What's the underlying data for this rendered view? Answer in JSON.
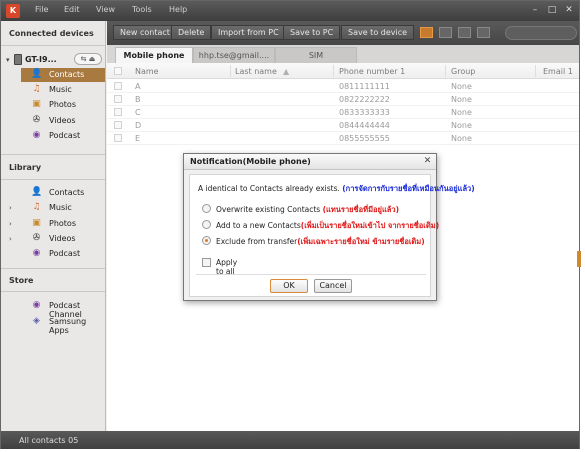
{
  "menu": {
    "logo": "K",
    "items": [
      "File",
      "Edit",
      "View",
      "Tools",
      "Help"
    ]
  },
  "window_controls": {
    "minimize": "–",
    "maximize": "□",
    "close": "✕"
  },
  "sidebar": {
    "connected_heading": "Connected devices",
    "device_name": "GT-I9...",
    "device_button": "⇆ ⏏",
    "device_items": [
      {
        "label": "Contacts",
        "icon": "contacts-icon",
        "glyph": "👤"
      },
      {
        "label": "Music",
        "icon": "music-icon",
        "glyph": "♫"
      },
      {
        "label": "Photos",
        "icon": "photos-icon",
        "glyph": "▣"
      },
      {
        "label": "Videos",
        "icon": "videos-icon",
        "glyph": "✇"
      },
      {
        "label": "Podcast",
        "icon": "podcast-icon",
        "glyph": "◉"
      }
    ],
    "library_heading": "Library",
    "library_items": [
      {
        "label": "Contacts",
        "icon": "contacts-icon",
        "glyph": "👤"
      },
      {
        "label": "Music",
        "icon": "music-icon",
        "glyph": "♫"
      },
      {
        "label": "Photos",
        "icon": "photos-icon",
        "glyph": "▣"
      },
      {
        "label": "Videos",
        "icon": "videos-icon",
        "glyph": "✇"
      },
      {
        "label": "Podcast",
        "icon": "podcast-icon",
        "glyph": "◉"
      }
    ],
    "store_heading": "Store",
    "store_items": [
      {
        "label": "Podcast Channel",
        "icon": "podcast-channel-icon",
        "glyph": "◉"
      },
      {
        "label": "Samsung Apps",
        "icon": "samsung-apps-icon",
        "glyph": "◈"
      }
    ]
  },
  "toolbar": {
    "buttons": [
      "New contact",
      "Delete",
      "Import from PC",
      "Save to PC",
      "Save to device"
    ]
  },
  "tabs": [
    "Mobile phone",
    "hhp.tse@gmail....",
    "SIM"
  ],
  "table": {
    "columns": [
      "Name",
      "Last name",
      "Phone number 1",
      "Group",
      "Email 1"
    ],
    "rows": [
      {
        "name": "A",
        "last": "",
        "phone": "0811111111",
        "group": "None"
      },
      {
        "name": "B",
        "last": "",
        "phone": "0822222222",
        "group": "None"
      },
      {
        "name": "C",
        "last": "",
        "phone": "0833333333",
        "group": "None"
      },
      {
        "name": "D",
        "last": "",
        "phone": "0844444444",
        "group": "None"
      },
      {
        "name": "E",
        "last": "",
        "phone": "0855555555",
        "group": "None"
      }
    ]
  },
  "status": {
    "text": "All contacts 05"
  },
  "dialog": {
    "title": "Notification(Mobile phone)",
    "close": "✕",
    "message": "A identical to Contacts already exists.",
    "message_note": "(การจัดการกับรายชื่อที่เหมือนกันอยู่แล้ว)",
    "options": [
      {
        "label": "Overwrite existing Contacts",
        "note": "(แทนรายชื่อที่มีอยู่แล้ว)",
        "selected": false
      },
      {
        "label": "Add to a new Contacts",
        "note": "(เพิ่มเป็นรายชื่อใหม่เข้าไป จากรายชื่อเดิม)",
        "selected": false
      },
      {
        "label": "Exclude from transfer",
        "note": "(เพิ่มเฉพาะรายชื่อใหม่ ข้ามรายชื่อเดิม)",
        "selected": true
      }
    ],
    "apply_all": "Apply to all",
    "ok": "OK",
    "cancel": "Cancel"
  },
  "colors": {
    "accent": "#a87a40",
    "note_blue": "#1a2bd6",
    "note_red": "#e01818"
  }
}
